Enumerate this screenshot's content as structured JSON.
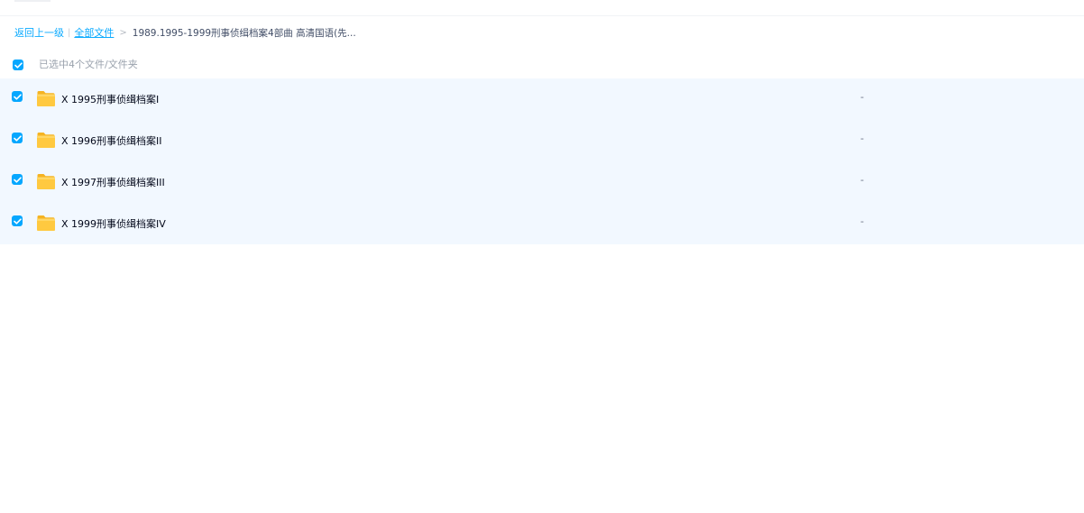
{
  "breadcrumb": {
    "back_label": "返回上一级",
    "divider": "|",
    "all_files_label": "全部文件",
    "arrow": ">",
    "current_path": "1989.1995-1999刑事侦缉档案4部曲 高清国语(先..."
  },
  "selection": {
    "summary": "已选中4个文件/文件夹",
    "all_checked": true
  },
  "colors": {
    "accent": "#06a7ff",
    "row_background": "#f2f8ff",
    "folder": "#ffc940"
  },
  "files": [
    {
      "name": "X 1995刑事侦缉档案Ⅰ",
      "size": "-",
      "type": "folder-icon",
      "checked": true
    },
    {
      "name": "X 1996刑事侦缉档案II",
      "size": "-",
      "type": "folder-icon",
      "checked": true
    },
    {
      "name": "X 1997刑事侦缉档案III",
      "size": "-",
      "type": "folder-icon",
      "checked": true
    },
    {
      "name": "X 1999刑事侦缉档案IV",
      "size": "-",
      "type": "folder-icon",
      "checked": true
    }
  ]
}
